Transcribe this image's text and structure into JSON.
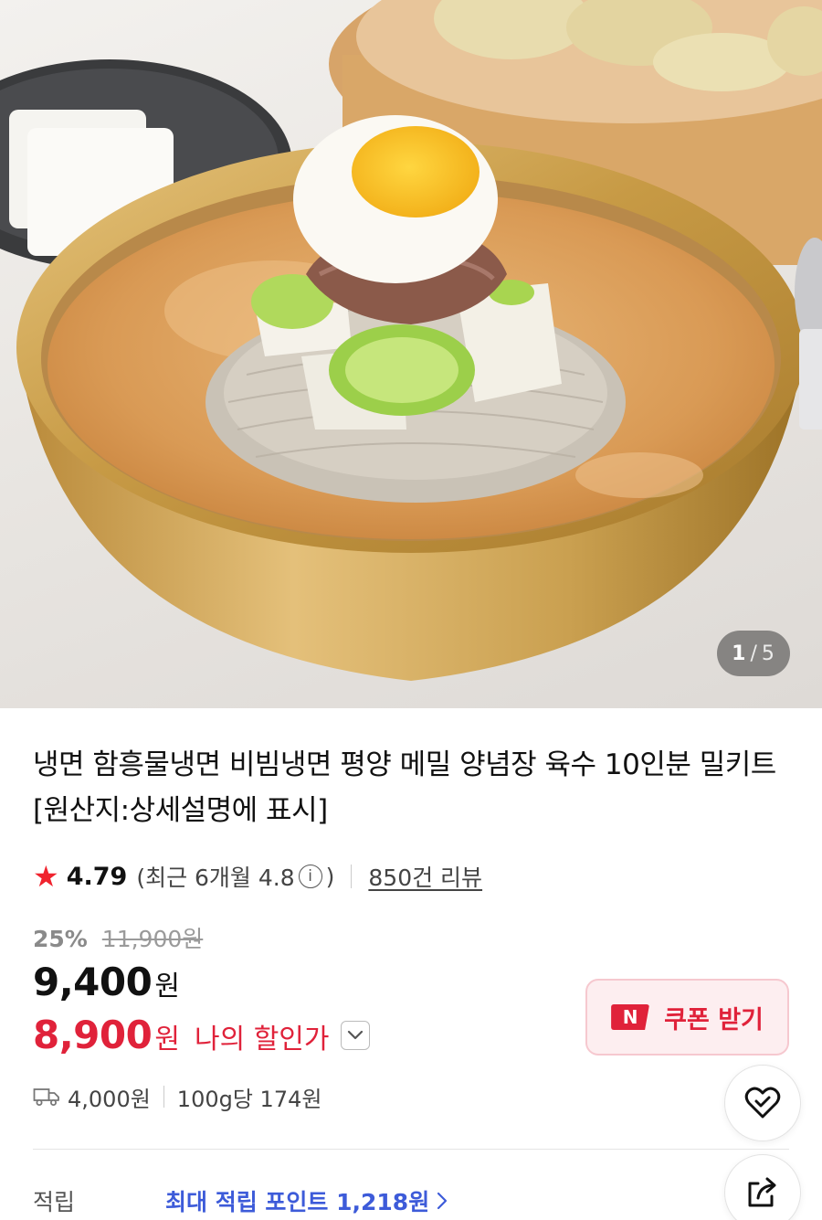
{
  "gallery": {
    "current": "1",
    "separator": "/",
    "total": "5"
  },
  "product": {
    "title": "냉면 함흥물냉면 비빔냉면 평양 메밀 양념장 육수 10인분 밀키트 [원산지:상세설명에 표시]"
  },
  "rating": {
    "score": "4.79",
    "recent_prefix": "(최근 6개월 4.8",
    "recent_suffix": ")",
    "reviews": "850건 리뷰"
  },
  "price": {
    "discount": "25%",
    "original": "11,900원",
    "sale": "9,400",
    "currency": "원",
    "my_price": "8,900",
    "my_label": "나의 할인가"
  },
  "coupon": {
    "badge": "N",
    "label": "쿠폰 받기"
  },
  "shipping": {
    "fee": "4,000원",
    "unit_price": "100g당 174원"
  },
  "points": {
    "label": "적립",
    "value": "최대 적립 포인트 1,218원"
  },
  "colors": {
    "accent_red": "#e0223a",
    "star": "#f0232e",
    "points_blue": "#3d5bd9"
  },
  "icons": [
    "star-icon",
    "info-icon",
    "chevron-down-icon",
    "truck-icon",
    "heart-icon",
    "share-icon"
  ]
}
